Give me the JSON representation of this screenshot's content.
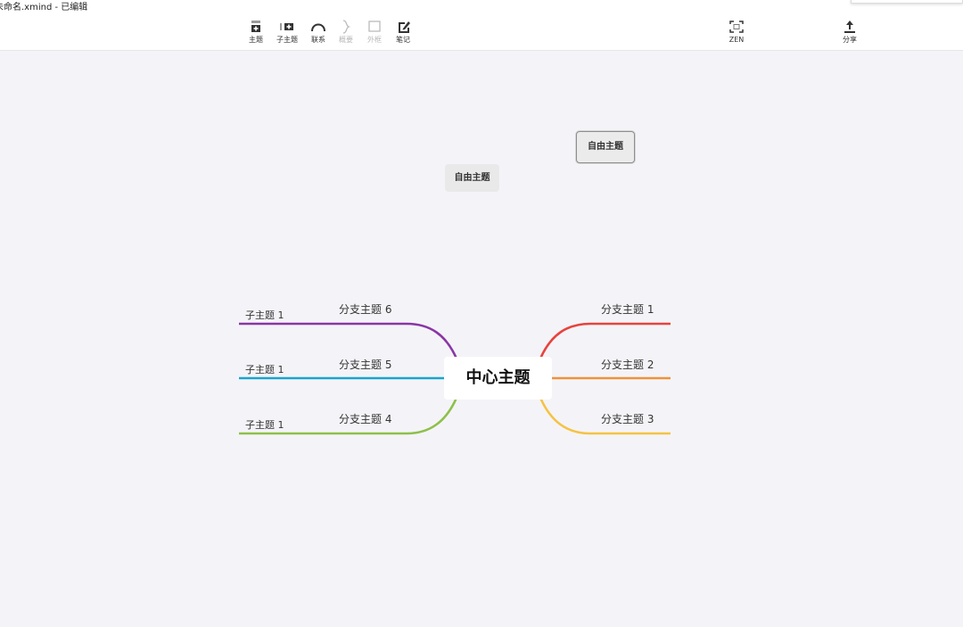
{
  "window": {
    "title": "未命名.xmind - 已编辑"
  },
  "toolbar": {
    "topic": "主题",
    "subtopic": "子主题",
    "relationship": "联系",
    "summary": "概要",
    "boundary": "外框",
    "note": "笔记",
    "zen": "ZEN",
    "share": "分享"
  },
  "mindmap": {
    "central": "中心主题",
    "branches": {
      "b1": "分支主题 1",
      "b2": "分支主题 2",
      "b3": "分支主题 3",
      "b4": "分支主题 4",
      "b5": "分支主题 5",
      "b6": "分支主题 6"
    },
    "subtopics": {
      "s6": "子主题 1",
      "s5": "子主题 1",
      "s4": "子主题 1"
    },
    "floating": {
      "f1": "自由主题",
      "f2": "自由主题"
    },
    "colors": {
      "b1": "#e8433d",
      "b2": "#f0913a",
      "b3": "#f5c344",
      "b4": "#8ec04a",
      "b5": "#17a5cf",
      "b6": "#8a36a6"
    }
  }
}
